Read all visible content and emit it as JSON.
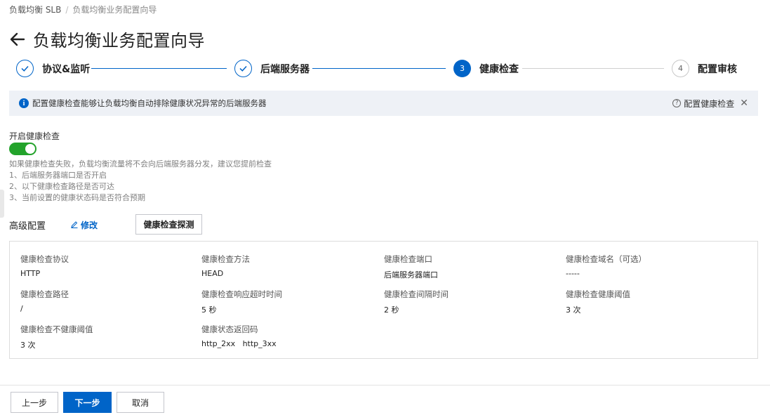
{
  "breadcrumb": {
    "root": "负载均衡 SLB",
    "separator": "/",
    "current": "负载均衡业务配置向导"
  },
  "page": {
    "title": "负载均衡业务配置向导"
  },
  "steps": [
    {
      "number": "1",
      "label": "协议&监听",
      "state": "done"
    },
    {
      "number": "2",
      "label": "后端服务器",
      "state": "done"
    },
    {
      "number": "3",
      "label": "健康检查",
      "state": "active"
    },
    {
      "number": "4",
      "label": "配置审核",
      "state": "todo"
    }
  ],
  "info_bar": {
    "text": "配置健康检查能够让负载均衡自动排除健康状况异常的后端服务器",
    "help_link": "配置健康检查",
    "help_icon_text": "?",
    "info_icon_text": "i",
    "close_icon_text": "✕"
  },
  "health_check": {
    "label": "开启健康检查",
    "enabled": true,
    "hints": [
      "如果健康检查失败，负载均衡流量将不会向后端服务器分发，建议您提前检查",
      "1、后端服务器端口是否开启",
      "2、以下健康检查路径是否可达",
      "3、当前设置的健康状态码是否符合预期"
    ]
  },
  "advanced": {
    "title": "高级配置",
    "edit_label": "修改",
    "probe_button": "健康检查探测"
  },
  "config": {
    "protocol": {
      "label": "健康检查协议",
      "value": "HTTP"
    },
    "method": {
      "label": "健康检查方法",
      "value": "HEAD"
    },
    "port": {
      "label": "健康检查端口",
      "value": "后端服务器端口"
    },
    "domain": {
      "label": "健康检查域名（可选）",
      "value": "-----"
    },
    "path": {
      "label": "健康检查路径",
      "value": "/"
    },
    "timeout": {
      "label": "健康检查响应超时时间",
      "value": "5 秒"
    },
    "interval": {
      "label": "健康检查间隔时间",
      "value": "2 秒"
    },
    "healthy_threshold": {
      "label": "健康检查健康阈值",
      "value": "3 次"
    },
    "unhealthy_threshold": {
      "label": "健康检查不健康阈值",
      "value": "3 次"
    },
    "status_codes": {
      "label": "健康状态返回码",
      "value": "http_2xx   http_3xx"
    }
  },
  "footer": {
    "prev": "上一步",
    "next": "下一步",
    "cancel": "取消"
  },
  "colors": {
    "primary": "#0064c8",
    "toggle_on": "#23a32b",
    "info_bg": "#eef1f6"
  },
  "icons": {
    "back": "arrow-left-icon",
    "done": "check-icon",
    "info": "info-icon",
    "help": "question-icon",
    "close": "close-icon",
    "edit": "pencil-icon"
  }
}
